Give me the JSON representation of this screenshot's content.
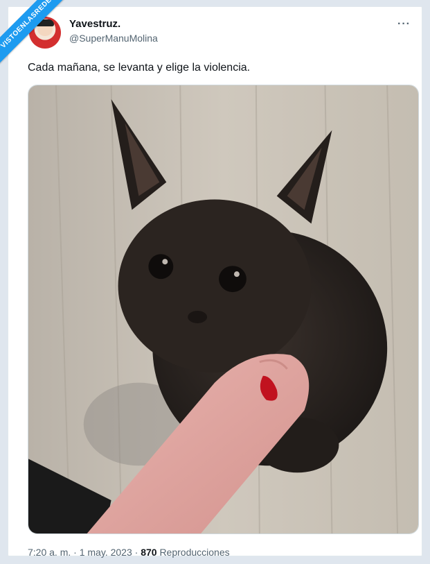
{
  "watermark": "VISTOENLASREDES",
  "tweet": {
    "author_name": "Yavestruz.",
    "author_handle": "@SuperManuMolina",
    "text": "Cada mañana, se levanta y elige la violencia.",
    "time": "7:20 a. m.",
    "date": "1 may. 2023",
    "views_count": "870",
    "views_label": "Reproducciones",
    "separator": "·"
  },
  "icons": {
    "more": "more-options-icon"
  },
  "colors": {
    "accent": "#1d9bf0",
    "text": "#0f1419",
    "muted": "#536471"
  }
}
